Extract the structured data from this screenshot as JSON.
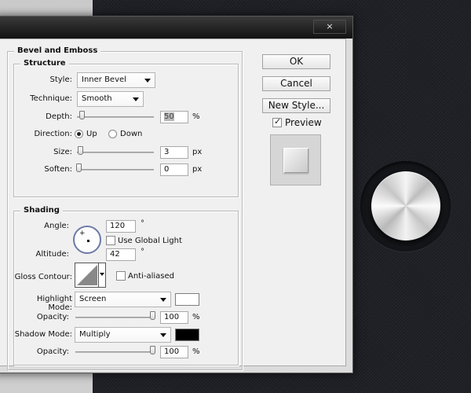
{
  "window": {
    "close_glyph": "×"
  },
  "bevel_emboss": {
    "title": "Bevel and Emboss",
    "structure": {
      "title": "Structure",
      "style_label": "Style:",
      "style_value": "Inner Bevel",
      "technique_label": "Technique:",
      "technique_value": "Smooth",
      "depth_label": "Depth:",
      "depth_value": "50",
      "depth_unit": "%",
      "depth_fraction": 0.05,
      "direction_label": "Direction:",
      "direction_up": "Up",
      "direction_down": "Down",
      "size_label": "Size:",
      "size_value": "3",
      "size_unit": "px",
      "soften_label": "Soften:",
      "soften_value": "0",
      "soften_unit": "px"
    },
    "shading": {
      "title": "Shading",
      "angle_label": "Angle:",
      "angle_value": "120",
      "angle_unit": "°",
      "use_global_light": "Use Global Light",
      "altitude_label": "Altitude:",
      "altitude_value": "42",
      "altitude_unit": "°",
      "gloss_contour_label": "Gloss Contour:",
      "anti_aliased": "Anti-aliased",
      "highlight_mode_label": "Highlight Mode:",
      "highlight_mode_value": "Screen",
      "highlight_color": "#ffffff",
      "highlight_opacity_label": "Opacity:",
      "highlight_opacity_value": "100",
      "highlight_opacity_unit": "%",
      "shadow_mode_label": "Shadow Mode:",
      "shadow_mode_value": "Multiply",
      "shadow_color": "#000000",
      "shadow_opacity_label": "Opacity:",
      "shadow_opacity_value": "100",
      "shadow_opacity_unit": "%"
    }
  },
  "buttons": {
    "ok": "OK",
    "cancel": "Cancel",
    "new_style": "New Style...",
    "preview_label": "Preview"
  }
}
